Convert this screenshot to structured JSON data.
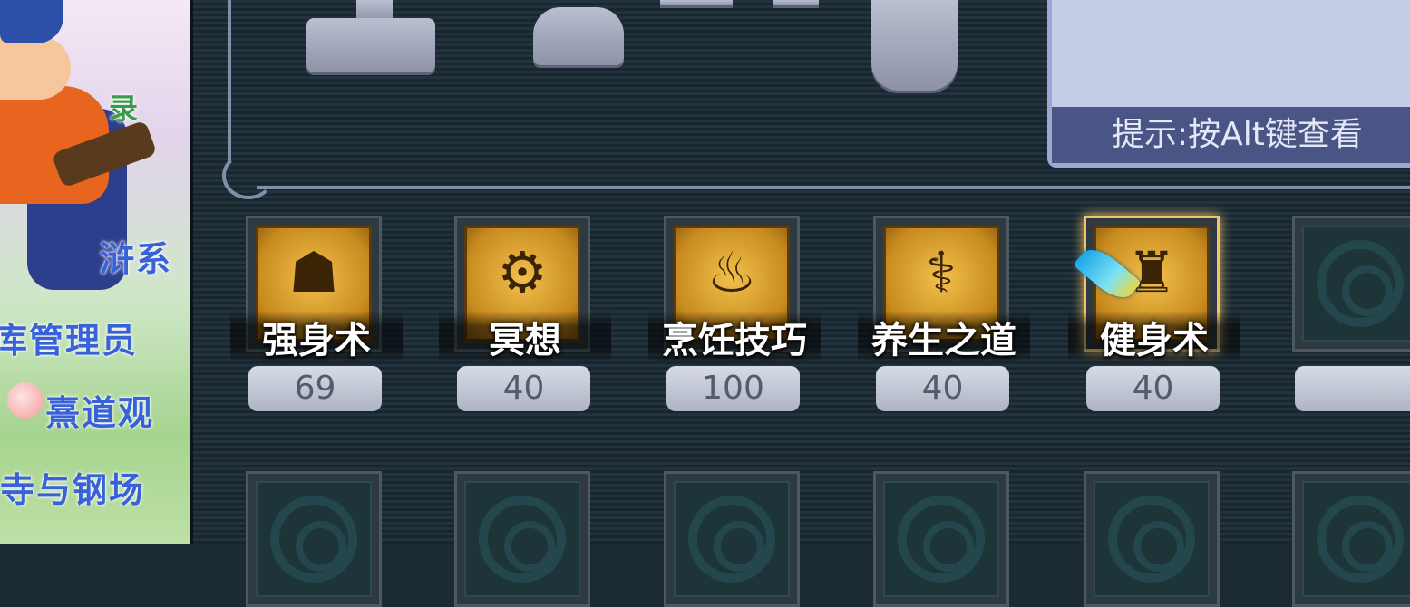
{
  "hint": {
    "text": "提示:按Alt键查看"
  },
  "background_text": [
    "录",
    "浒系",
    "库管理员",
    "熹道观",
    "寺与钢场"
  ],
  "skills": [
    {
      "name": "强身术",
      "level": "69",
      "icon": "strength-skill-icon",
      "glyph": "☗"
    },
    {
      "name": "冥想",
      "level": "40",
      "icon": "meditation-skill-icon",
      "glyph": "⚙"
    },
    {
      "name": "烹饪技巧",
      "level": "100",
      "icon": "cooking-skill-icon",
      "glyph": "♨"
    },
    {
      "name": "养生之道",
      "level": "40",
      "icon": "health-skill-icon",
      "glyph": "⚕"
    },
    {
      "name": "健身术",
      "level": "40",
      "icon": "fitness-skill-icon",
      "glyph": "♜"
    }
  ],
  "colors": {
    "accent_gold": "#f1c46b",
    "panel_bg": "#1c2a33",
    "level_pill": "#c8cddb"
  }
}
